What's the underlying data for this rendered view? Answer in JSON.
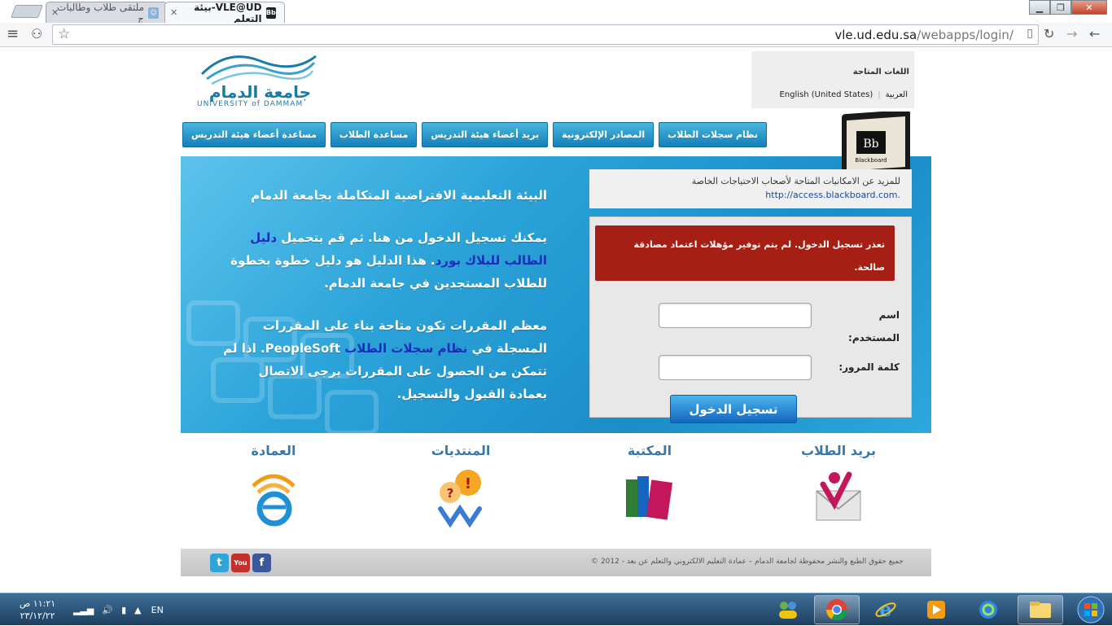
{
  "browser": {
    "tabs": [
      {
        "title": "ملتقى طلاب وطالبات ج",
        "state": "inactive"
      },
      {
        "title": "VLE@UD-بيئة التعلم",
        "state": "active"
      }
    ],
    "url_host": "vle.ud.edu.sa",
    "url_path": "/webapps/login/"
  },
  "lang": {
    "title": "اللغات المتاحة",
    "options": [
      "العربية",
      "English (United States)"
    ]
  },
  "logo": {
    "ar": "جامعة الدمام",
    "en": "UNIVERSITY of DAMMAM"
  },
  "nav": {
    "items": [
      "مساعدة أعضاء هيئة التدريس",
      "مساعدة الطلاب",
      "بريد أعضاء هيئة التدريس",
      "المصادر الإلكترونية",
      "نظام سجلات الطلاب"
    ]
  },
  "monitor": {
    "logo_text": "Bb",
    "brand": "Blackboard"
  },
  "access": {
    "text": "للمزيد عن الامكانيات المتاحة لأصحاب الاحتياجات الخاصة",
    "link": "http://access.blackboard.com."
  },
  "hero": {
    "title": "البيئة التعليمية الافتراضية المتكاملة بجامعة الدمام",
    "p1_before": "يمكنك تسجيل الدخول من هنا. ثم قم بتحميل ",
    "p1_link": "دليل الطالب للبلاك بورد",
    "p1_after": ". هذا الدليل هو دليل خطوة بخطوة للطلاب المستجدين في جامعة الدمام.",
    "p2_before": "معظم المقررات تكون متاحة بناء على المقررات المسجلة في ",
    "p2_link": "نظام سجلات الطلاب",
    "p2_after": " PeopleSoft. اذا لم تتمكن من الحصول على المقررات يرجى الاتصال بعمادة القبول والتسجيل."
  },
  "login": {
    "error": "تعذر تسجيل الدخول. لم يتم توفير مؤهلات اعتماد مصادقة صالحة.",
    "username_label": "اسم المستخدم:",
    "password_label": "كلمة المرور:",
    "username_value": "",
    "password_value": "",
    "submit": "تسجيل الدخول"
  },
  "quick": [
    {
      "label": "بريد الطلاب",
      "icon": "mail-icon"
    },
    {
      "label": "المكتبة",
      "icon": "books-icon"
    },
    {
      "label": "المنتديات",
      "icon": "forum-icon"
    },
    {
      "label": "العمادة",
      "icon": "e-learning-icon"
    }
  ],
  "footer": {
    "copyright": "جميع حقوق الطبع والنشر محفوظة لجامعة الدمام – عمادة التعليم الالكتروني والتعلم عن بعد - 2012 ©",
    "social": [
      {
        "name": "facebook-icon",
        "glyph": "f",
        "color": "#3b5998"
      },
      {
        "name": "youtube-icon",
        "glyph": "You",
        "color": "#c4302b"
      },
      {
        "name": "twitter-icon",
        "glyph": "t",
        "color": "#33a4d8"
      }
    ]
  },
  "taskbar": {
    "time": "١١:٢١ ص",
    "date": "٢٣/١٢/٢٢",
    "lang": "EN"
  },
  "colors": {
    "accent": "#1b8dc7",
    "error": "#a51f15",
    "nav": "#137fb7"
  }
}
